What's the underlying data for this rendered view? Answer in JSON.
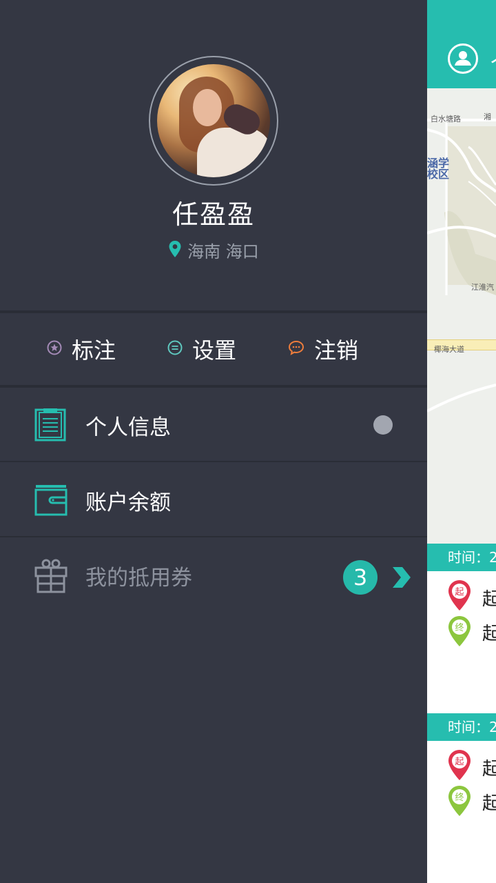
{
  "user": {
    "name": "任盈盈",
    "location": "海南 海口"
  },
  "quick_actions": {
    "mark": "标注",
    "settings": "设置",
    "logout": "注销"
  },
  "menu": {
    "profile": "个人信息",
    "balance": "账户余额",
    "coupons": "我的抵用券",
    "coupon_count": "3"
  },
  "main": {
    "title_fragment": "个",
    "map_labels": {
      "road_1": "白水塘路",
      "road_2": "湘",
      "school_1": "涵学",
      "school_2": "校区",
      "company": "江淮汽",
      "avenue": "椰海大道"
    },
    "trips": [
      {
        "time_label": "时间：2",
        "start": "起",
        "end": "起",
        "start_pin": "起",
        "end_pin": "终"
      },
      {
        "time_label": "时间：2",
        "start": "起",
        "end": "起",
        "start_pin": "起",
        "end_pin": "终"
      }
    ]
  },
  "colors": {
    "accent": "#26bdaf",
    "drawer_bg": "#343743",
    "start_pin": "#e0344e",
    "end_pin": "#8cc63e"
  }
}
